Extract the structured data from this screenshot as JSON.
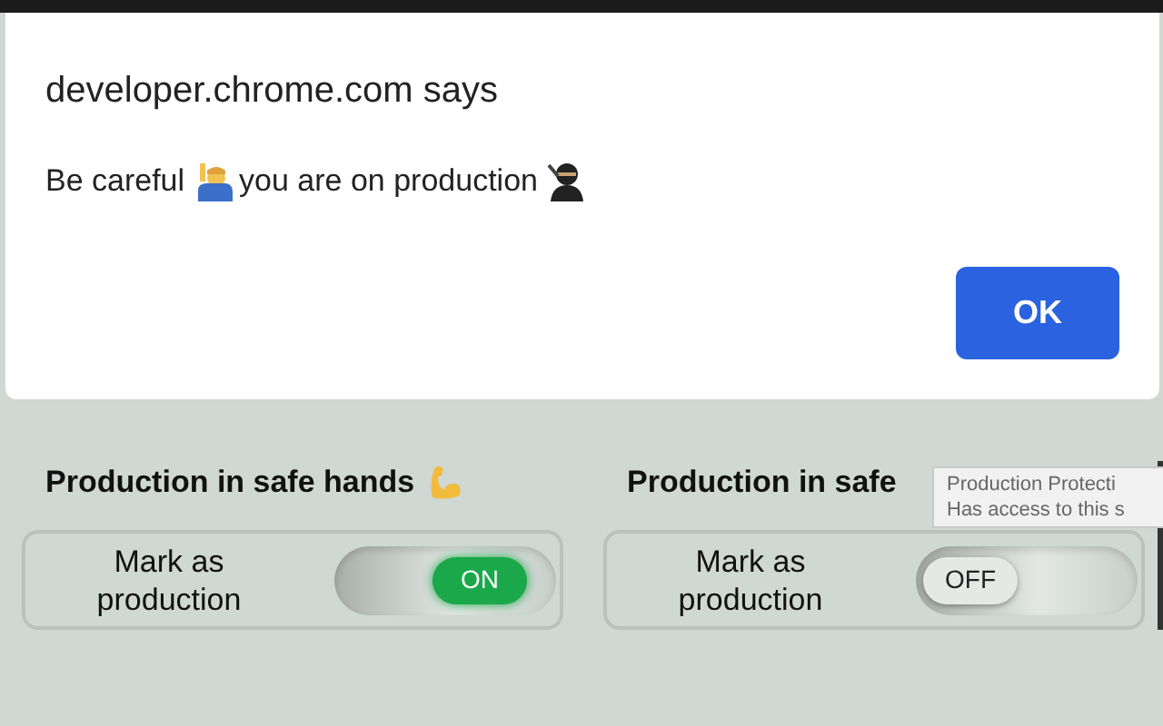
{
  "dialog": {
    "title": "developer.chrome.com says",
    "message": [
      "Be careful",
      "you are on production"
    ],
    "button": "OK"
  },
  "panels": [
    {
      "heading": "Production in safe hands",
      "icon": true,
      "label": "Mark as production",
      "toggle": {
        "on": true,
        "text": "ON"
      }
    },
    {
      "heading": "Production in safe",
      "icon": false,
      "label": "Mark as production",
      "toggle": {
        "on": false,
        "text": "OFF"
      }
    }
  ],
  "tooltip": {
    "lines": [
      "Production Protecti",
      "Has access to this s"
    ]
  }
}
